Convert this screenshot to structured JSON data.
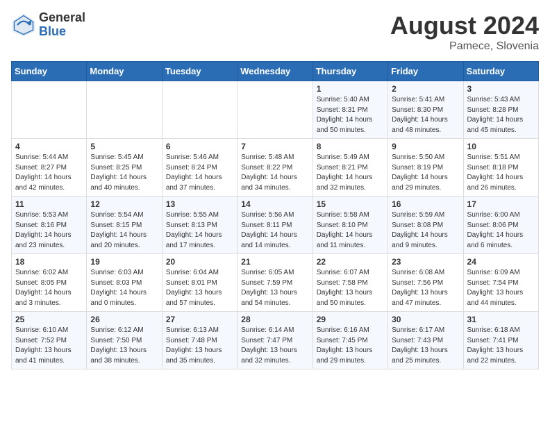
{
  "header": {
    "logo_general": "General",
    "logo_blue": "Blue",
    "month_year": "August 2024",
    "location": "Pamece, Slovenia"
  },
  "weekdays": [
    "Sunday",
    "Monday",
    "Tuesday",
    "Wednesday",
    "Thursday",
    "Friday",
    "Saturday"
  ],
  "weeks": [
    [
      {
        "day": "",
        "sunrise": "",
        "sunset": "",
        "daylight": ""
      },
      {
        "day": "",
        "sunrise": "",
        "sunset": "",
        "daylight": ""
      },
      {
        "day": "",
        "sunrise": "",
        "sunset": "",
        "daylight": ""
      },
      {
        "day": "",
        "sunrise": "",
        "sunset": "",
        "daylight": ""
      },
      {
        "day": "1",
        "sunrise": "Sunrise: 5:40 AM",
        "sunset": "Sunset: 8:31 PM",
        "daylight": "Daylight: 14 hours and 50 minutes."
      },
      {
        "day": "2",
        "sunrise": "Sunrise: 5:41 AM",
        "sunset": "Sunset: 8:30 PM",
        "daylight": "Daylight: 14 hours and 48 minutes."
      },
      {
        "day": "3",
        "sunrise": "Sunrise: 5:43 AM",
        "sunset": "Sunset: 8:28 PM",
        "daylight": "Daylight: 14 hours and 45 minutes."
      }
    ],
    [
      {
        "day": "4",
        "sunrise": "Sunrise: 5:44 AM",
        "sunset": "Sunset: 8:27 PM",
        "daylight": "Daylight: 14 hours and 42 minutes."
      },
      {
        "day": "5",
        "sunrise": "Sunrise: 5:45 AM",
        "sunset": "Sunset: 8:25 PM",
        "daylight": "Daylight: 14 hours and 40 minutes."
      },
      {
        "day": "6",
        "sunrise": "Sunrise: 5:46 AM",
        "sunset": "Sunset: 8:24 PM",
        "daylight": "Daylight: 14 hours and 37 minutes."
      },
      {
        "day": "7",
        "sunrise": "Sunrise: 5:48 AM",
        "sunset": "Sunset: 8:22 PM",
        "daylight": "Daylight: 14 hours and 34 minutes."
      },
      {
        "day": "8",
        "sunrise": "Sunrise: 5:49 AM",
        "sunset": "Sunset: 8:21 PM",
        "daylight": "Daylight: 14 hours and 32 minutes."
      },
      {
        "day": "9",
        "sunrise": "Sunrise: 5:50 AM",
        "sunset": "Sunset: 8:19 PM",
        "daylight": "Daylight: 14 hours and 29 minutes."
      },
      {
        "day": "10",
        "sunrise": "Sunrise: 5:51 AM",
        "sunset": "Sunset: 8:18 PM",
        "daylight": "Daylight: 14 hours and 26 minutes."
      }
    ],
    [
      {
        "day": "11",
        "sunrise": "Sunrise: 5:53 AM",
        "sunset": "Sunset: 8:16 PM",
        "daylight": "Daylight: 14 hours and 23 minutes."
      },
      {
        "day": "12",
        "sunrise": "Sunrise: 5:54 AM",
        "sunset": "Sunset: 8:15 PM",
        "daylight": "Daylight: 14 hours and 20 minutes."
      },
      {
        "day": "13",
        "sunrise": "Sunrise: 5:55 AM",
        "sunset": "Sunset: 8:13 PM",
        "daylight": "Daylight: 14 hours and 17 minutes."
      },
      {
        "day": "14",
        "sunrise": "Sunrise: 5:56 AM",
        "sunset": "Sunset: 8:11 PM",
        "daylight": "Daylight: 14 hours and 14 minutes."
      },
      {
        "day": "15",
        "sunrise": "Sunrise: 5:58 AM",
        "sunset": "Sunset: 8:10 PM",
        "daylight": "Daylight: 14 hours and 11 minutes."
      },
      {
        "day": "16",
        "sunrise": "Sunrise: 5:59 AM",
        "sunset": "Sunset: 8:08 PM",
        "daylight": "Daylight: 14 hours and 9 minutes."
      },
      {
        "day": "17",
        "sunrise": "Sunrise: 6:00 AM",
        "sunset": "Sunset: 8:06 PM",
        "daylight": "Daylight: 14 hours and 6 minutes."
      }
    ],
    [
      {
        "day": "18",
        "sunrise": "Sunrise: 6:02 AM",
        "sunset": "Sunset: 8:05 PM",
        "daylight": "Daylight: 14 hours and 3 minutes."
      },
      {
        "day": "19",
        "sunrise": "Sunrise: 6:03 AM",
        "sunset": "Sunset: 8:03 PM",
        "daylight": "Daylight: 14 hours and 0 minutes."
      },
      {
        "day": "20",
        "sunrise": "Sunrise: 6:04 AM",
        "sunset": "Sunset: 8:01 PM",
        "daylight": "Daylight: 13 hours and 57 minutes."
      },
      {
        "day": "21",
        "sunrise": "Sunrise: 6:05 AM",
        "sunset": "Sunset: 7:59 PM",
        "daylight": "Daylight: 13 hours and 54 minutes."
      },
      {
        "day": "22",
        "sunrise": "Sunrise: 6:07 AM",
        "sunset": "Sunset: 7:58 PM",
        "daylight": "Daylight: 13 hours and 50 minutes."
      },
      {
        "day": "23",
        "sunrise": "Sunrise: 6:08 AM",
        "sunset": "Sunset: 7:56 PM",
        "daylight": "Daylight: 13 hours and 47 minutes."
      },
      {
        "day": "24",
        "sunrise": "Sunrise: 6:09 AM",
        "sunset": "Sunset: 7:54 PM",
        "daylight": "Daylight: 13 hours and 44 minutes."
      }
    ],
    [
      {
        "day": "25",
        "sunrise": "Sunrise: 6:10 AM",
        "sunset": "Sunset: 7:52 PM",
        "daylight": "Daylight: 13 hours and 41 minutes."
      },
      {
        "day": "26",
        "sunrise": "Sunrise: 6:12 AM",
        "sunset": "Sunset: 7:50 PM",
        "daylight": "Daylight: 13 hours and 38 minutes."
      },
      {
        "day": "27",
        "sunrise": "Sunrise: 6:13 AM",
        "sunset": "Sunset: 7:48 PM",
        "daylight": "Daylight: 13 hours and 35 minutes."
      },
      {
        "day": "28",
        "sunrise": "Sunrise: 6:14 AM",
        "sunset": "Sunset: 7:47 PM",
        "daylight": "Daylight: 13 hours and 32 minutes."
      },
      {
        "day": "29",
        "sunrise": "Sunrise: 6:16 AM",
        "sunset": "Sunset: 7:45 PM",
        "daylight": "Daylight: 13 hours and 29 minutes."
      },
      {
        "day": "30",
        "sunrise": "Sunrise: 6:17 AM",
        "sunset": "Sunset: 7:43 PM",
        "daylight": "Daylight: 13 hours and 25 minutes."
      },
      {
        "day": "31",
        "sunrise": "Sunrise: 6:18 AM",
        "sunset": "Sunset: 7:41 PM",
        "daylight": "Daylight: 13 hours and 22 minutes."
      }
    ]
  ]
}
